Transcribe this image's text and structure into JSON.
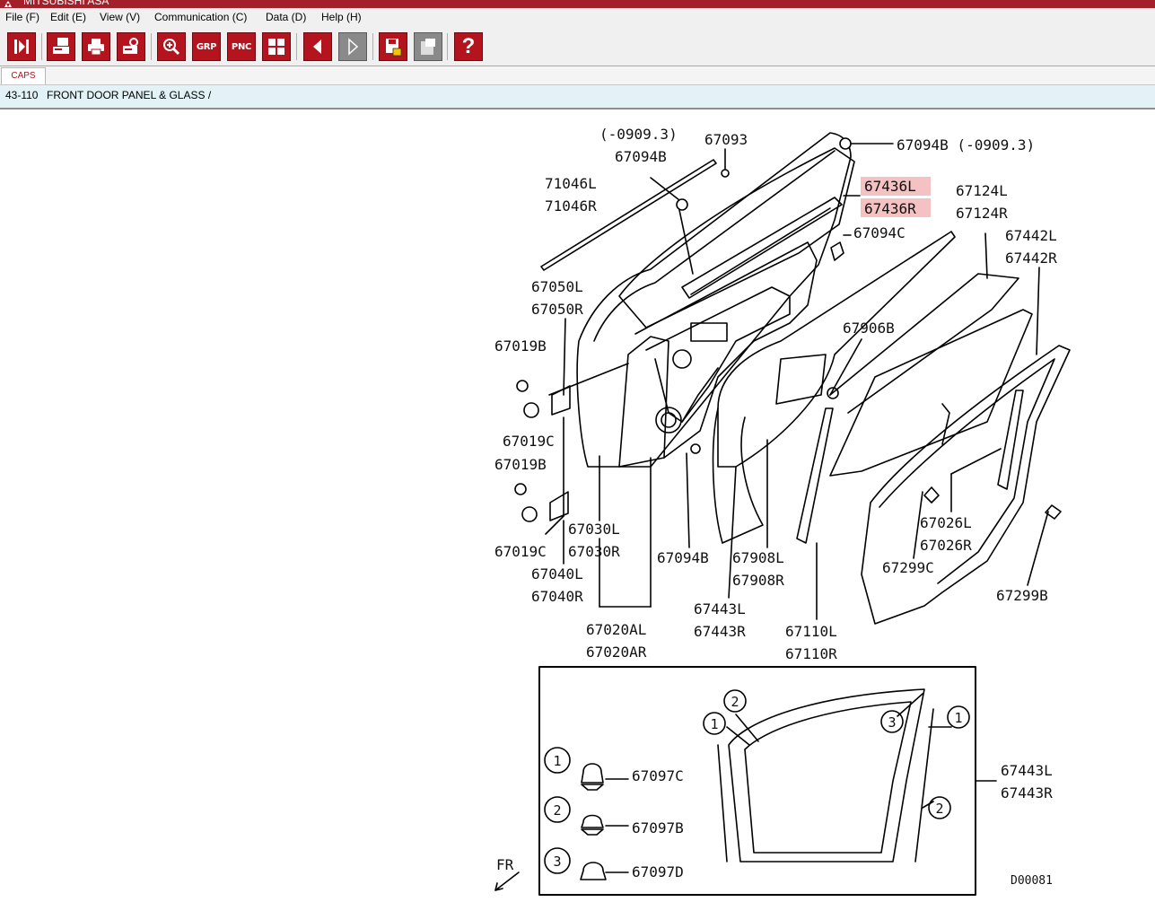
{
  "window": {
    "title": "MITSUBISHI ASA"
  },
  "menu": [
    {
      "label": "File (F)"
    },
    {
      "label": "Edit (E)"
    },
    {
      "label": "View (V)"
    },
    {
      "label": "Communication (C)"
    },
    {
      "label": "Data (D)"
    },
    {
      "label": "Help (H)"
    }
  ],
  "toolbar": {
    "grp_label": "GRP",
    "pnc_label": "PNC",
    "help_label": "?"
  },
  "tabs": [
    {
      "label": "CAPS"
    }
  ],
  "path": {
    "code": "43-110",
    "title": "FRONT DOOR PANEL & GLASS /"
  },
  "diagram": {
    "highlight_color": "#f4c2c2",
    "labels": {
      "date_range_1": "(-0909.3)",
      "p67093": "67093",
      "p67094B_a": "67094B",
      "p67094B_b": "67094B (-0909.3)",
      "p71046L": "71046L",
      "p71046R": "71046R",
      "p67436L": "67436L",
      "p67436R": "67436R",
      "p67124L": "67124L",
      "p67124R": "67124R",
      "p67094C": "67094C",
      "p67442L": "67442L",
      "p67442R": "67442R",
      "p67050L": "67050L",
      "p67050R": "67050R",
      "p67906B": "67906B",
      "p67019B_a": "67019B",
      "p67019C_a": "67019C",
      "p67019B_b": "67019B",
      "p67019C_b": "67019C",
      "p67030L": "67030L",
      "p67030R": "67030R",
      "p67040L": "67040L",
      "p67040R": "67040R",
      "p67094B_c": "67094B",
      "p67908L": "67908L",
      "p67908R": "67908R",
      "p67026L": "67026L",
      "p67026R": "67026R",
      "p67299C": "67299C",
      "p67299B": "67299B",
      "p67443L_a": "67443L",
      "p67443R_a": "67443R",
      "p67110L": "67110L",
      "p67110R": "67110R",
      "p67020AL": "67020AL",
      "p67020AR": "67020AR",
      "p67097C": "67097C",
      "p67097B": "67097B",
      "p67097D": "67097D",
      "p67443L_b": "67443L",
      "p67443R_b": "67443R",
      "fr": "FR",
      "drawing_id": "D00081",
      "c1": "1",
      "c2": "2",
      "c3": "3"
    }
  }
}
